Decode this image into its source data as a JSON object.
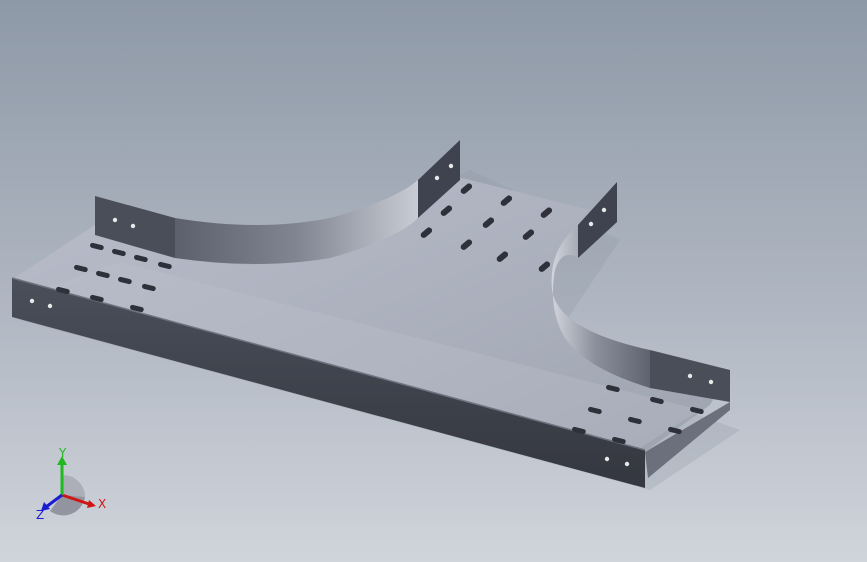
{
  "viewport": {
    "background_top": "#8f9aa8",
    "background_bottom": "#cfd3da"
  },
  "model": {
    "name": "cable-tray-tee",
    "colors": {
      "floor": "#aeb2bf",
      "floor_light": "#c2c6d2",
      "wall_dark": "#3b3f4a",
      "wall_mid": "#555a66",
      "slot": "#2a2d35",
      "hole": "#e6e6e6"
    }
  },
  "triad": {
    "x_label": "X",
    "y_label": "Y",
    "z_label": "Z",
    "x_color": "#d01515",
    "y_color": "#22b822",
    "z_color": "#1b1bd0"
  }
}
